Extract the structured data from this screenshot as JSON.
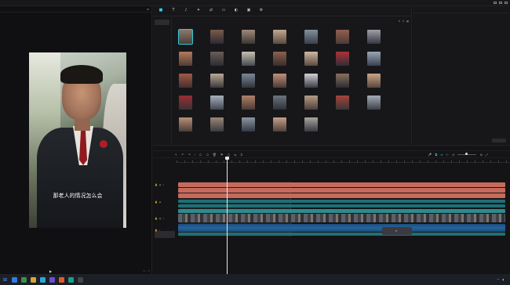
{
  "titlebar": {
    "logo": "",
    "menu": "",
    "autosave": "",
    "doc_title": "",
    "badge1": "",
    "badge2": "",
    "export": ""
  },
  "player": {
    "header": "",
    "subtitle": "那老人的情况怎么会",
    "subtitle2": "",
    "timecode": "",
    "colors": {
      "accent": "#2fd0e0"
    }
  },
  "media": {
    "tools": [
      {
        "icon": "■",
        "label": ""
      },
      {
        "icon": "T",
        "label": ""
      },
      {
        "icon": "♪",
        "label": ""
      },
      {
        "icon": "✦",
        "label": ""
      },
      {
        "icon": "⇄",
        "label": ""
      },
      {
        "icon": "▭",
        "label": ""
      },
      {
        "icon": "◐",
        "label": ""
      },
      {
        "icon": "▣",
        "label": ""
      },
      {
        "icon": "⚙",
        "label": ""
      }
    ],
    "side_items": [
      "",
      "",
      "",
      "",
      "",
      "",
      "",
      ""
    ],
    "import_label": "",
    "crumb": "",
    "thumbs": [
      {
        "cap": "",
        "c1": "#4a3f38",
        "c2": "#8a7a6a"
      },
      {
        "cap": "",
        "c1": "#2b2a33",
        "c2": "#7c5a4a"
      },
      {
        "cap": "",
        "c1": "#3b3532",
        "c2": "#a08a7a"
      },
      {
        "cap": "",
        "c1": "#5c4a3e",
        "c2": "#c0a890"
      },
      {
        "cap": "",
        "c1": "#3a3f4a",
        "c2": "#8090a0"
      },
      {
        "cap": "",
        "c1": "#4d3a36",
        "c2": "#906050"
      },
      {
        "cap": "",
        "c1": "#333740",
        "c2": "#a0a0a8"
      },
      {
        "cap": "",
        "c1": "#503c34",
        "c2": "#b47a5a"
      },
      {
        "cap": "",
        "c1": "#2c2d32",
        "c2": "#6a5d58"
      },
      {
        "cap": "",
        "c1": "#444a52",
        "c2": "#c8c0b0"
      },
      {
        "cap": "",
        "c1": "#3a2d2a",
        "c2": "#8c6050"
      },
      {
        "cap": "",
        "c1": "#5a4a40",
        "c2": "#d0b8a0"
      },
      {
        "cap": "",
        "c1": "#2e2f36",
        "c2": "#b03038"
      },
      {
        "cap": "",
        "c1": "#384050",
        "c2": "#9aa6b6"
      },
      {
        "cap": "",
        "c1": "#462f2c",
        "c2": "#a05a48"
      },
      {
        "cap": "",
        "c1": "#3c3a38",
        "c2": "#b8a898"
      },
      {
        "cap": "",
        "c1": "#30343c",
        "c2": "#7a8898"
      },
      {
        "cap": "",
        "c1": "#4a3a34",
        "c2": "#c0907a"
      },
      {
        "cap": "",
        "c1": "#3a3c44",
        "c2": "#d0d0d4"
      },
      {
        "cap": "",
        "c1": "#2c2c30",
        "c2": "#8a7060"
      },
      {
        "cap": "",
        "c1": "#5a463c",
        "c2": "#caa488"
      },
      {
        "cap": "",
        "c1": "#3a3234",
        "c2": "#9c2c34"
      },
      {
        "cap": "",
        "c1": "#404652",
        "c2": "#a8b0bc"
      },
      {
        "cap": "",
        "c1": "#4a3a36",
        "c2": "#b08068"
      },
      {
        "cap": "",
        "c1": "#2e3036",
        "c2": "#6c7480"
      },
      {
        "cap": "",
        "c1": "#4c403a",
        "c2": "#b89c86"
      },
      {
        "cap": "",
        "c1": "#3a3536",
        "c2": "#a6433e"
      },
      {
        "cap": "",
        "c1": "#3c4048",
        "c2": "#a4acb8"
      },
      {
        "cap": "",
        "c1": "#4a3d36",
        "c2": "#b89078"
      },
      {
        "cap": "",
        "c1": "#3a3a3e",
        "c2": "#9a8878"
      },
      {
        "cap": "",
        "c1": "#333842",
        "c2": "#8c96a4"
      },
      {
        "cap": "",
        "c1": "#4e4038",
        "c2": "#c4a08a"
      },
      {
        "cap": "",
        "c1": "#36383e",
        "c2": "#aaa6a0"
      }
    ]
  },
  "props": {
    "header": "",
    "rows": [
      {
        "k": "",
        "v": ""
      },
      {
        "k": "",
        "v": ""
      },
      {
        "k": "",
        "v": ""
      },
      {
        "k": "",
        "v": ""
      },
      {
        "k": "",
        "v": ""
      },
      {
        "k": "",
        "v": ""
      },
      {
        "k": "",
        "v": ""
      },
      {
        "k": "",
        "v": ""
      },
      {
        "k": "",
        "v": ""
      }
    ],
    "rows2": [
      {
        "k": "",
        "v": ""
      },
      {
        "k": "",
        "v": ""
      },
      {
        "k": "",
        "v": ""
      }
    ],
    "button": ""
  },
  "timeline": {
    "header": "",
    "clip_label": "",
    "toast": "",
    "cover": "",
    "colors": {
      "subtitle_track": "#c66a5c",
      "text_track": "#1f6f76",
      "audio_track": "#2663a0"
    }
  },
  "taskbar": {
    "time": "",
    "date": "",
    "apps": [
      "#2f7de1",
      "#3b8f4a",
      "#d8a33a",
      "#2aa7d8",
      "#6a4fd0",
      "#e05a2a",
      "#16a085",
      "#444"
    ]
  }
}
